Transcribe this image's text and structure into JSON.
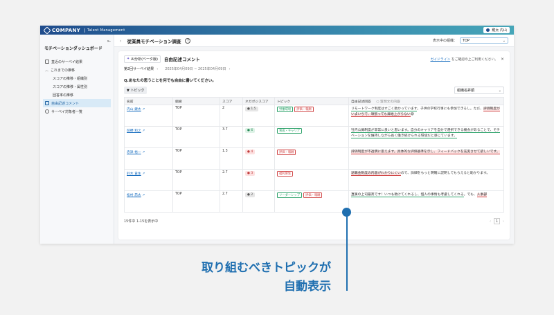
{
  "app": {
    "logo": "COMPANY",
    "product": "Talent Management",
    "user": "鍵太 内山"
  },
  "sidebar": {
    "title": "モチベーションダッシュボード",
    "items": [
      {
        "label": "直近のサーベイ結果",
        "icon": "document-icon"
      },
      {
        "label": "これまでの推移",
        "icon": "chevron-up-icon"
      },
      {
        "label": "スコアの推移・組織別",
        "icon": ""
      },
      {
        "label": "スコアの推移・属性別",
        "icon": ""
      },
      {
        "label": "回答率の推移",
        "icon": ""
      },
      {
        "label": "自由記述コメント",
        "icon": "comment-icon"
      },
      {
        "label": "サーベイ対象者一覧",
        "icon": "person-icon"
      }
    ]
  },
  "header": {
    "title": "従業員モチベーション調査",
    "org_label": "表示中の組織：",
    "org_value": "TOP"
  },
  "card": {
    "ai_label": "AI分析(ベータ版)",
    "title": "自由記述コメント",
    "guide_link": "ガイドライン",
    "guide_text": "をご確認の上ご利用ください。",
    "survey_label": "第2回サーベイ結果",
    "survey_period": "2025年04月09日 ~ 2025年04月09日",
    "question": "Q.あなたの思うことを何でも自由に書いてください。",
    "topic_button": "トピック",
    "sort_select": "組織名昇順"
  },
  "table": {
    "headers": [
      "名前",
      "組織",
      "スコア",
      "ネガポジスコア",
      "トピック",
      "自由記述回答"
    ],
    "legend": "質問文の内容",
    "rows": [
      {
        "name": "内山 鍵太",
        "org": "TOP",
        "score": "2",
        "np": "1.5",
        "np_color": "#e6e6e6",
        "np_text": "#555",
        "tags": [
          {
            "label": "労働環境",
            "color": "#2ea36b"
          },
          {
            "label": "評価・報酬",
            "color": "#d24a4a"
          }
        ],
        "c1": "リモートワーク制度はすごく助かっています",
        "c2": "。子供の学校行事にも参加できるし。ただ、",
        "c3": "評価制度がいまいちで、頑張っても昇給上がらない",
        "c4": "😅"
      },
      {
        "name": "前野 和之",
        "org": "TOP",
        "score": "3.7",
        "np": "6",
        "np_color": "#ddf2e6",
        "np_text": "#2a8a58",
        "tags": [
          {
            "label": "育成・キャリア",
            "color": "#2ea36b"
          }
        ],
        "c1": "社内公募制度が非常に良いと思います。自分のキャリアを自分で選択できる機会があることで、モチベーションを維持しながら長く働き続けられる環境だと感じています。",
        "c2": "",
        "c3": "",
        "c4": ""
      },
      {
        "name": "赤津 裕一",
        "org": "TOP",
        "score": "1.3",
        "np": "4",
        "np_color": "#fde0e0",
        "np_text": "#c03a3a",
        "tags": [
          {
            "label": "評価・報酬",
            "color": "#d24a4a"
          }
        ],
        "c1": "",
        "c2": "",
        "c3": "評価制度が不透明に思えます。具体的な評価基準を示し、フィードバックを充実させて欲しいです。",
        "c4": ""
      },
      {
        "name": "鈴木 貴生",
        "org": "TOP",
        "score": "2.7",
        "np": "3",
        "np_color": "#fde0e0",
        "np_text": "#c03a3a",
        "tags": [
          {
            "label": "福利厚生",
            "color": "#d24a4a"
          }
        ],
        "c1": "",
        "c2": "",
        "c3": "退職金制度の内容がわかりにくい",
        "c4": "ので、詳細をもっと明確に説明してもらえると助かります。"
      },
      {
        "name": "松村 昂太",
        "org": "TOP",
        "score": "2.7",
        "np": "2",
        "np_color": "#e6e6e6",
        "np_text": "#555",
        "tags": [
          {
            "label": "リーダーシップ",
            "color": "#2ea36b"
          },
          {
            "label": "評価・報酬",
            "color": "#d24a4a"
          }
        ],
        "c1": "直属の上司最高です！いつも助けてくれるし、個人の事情も考慮してくれる",
        "c2": "。でも、",
        "c3": "人事部",
        "c4": ""
      }
    ]
  },
  "pager": {
    "summary": "15件中 1-15を表示中",
    "page": "1"
  },
  "annotation": {
    "line1": "取り組むべきトピックが",
    "line2": "自動表示"
  }
}
